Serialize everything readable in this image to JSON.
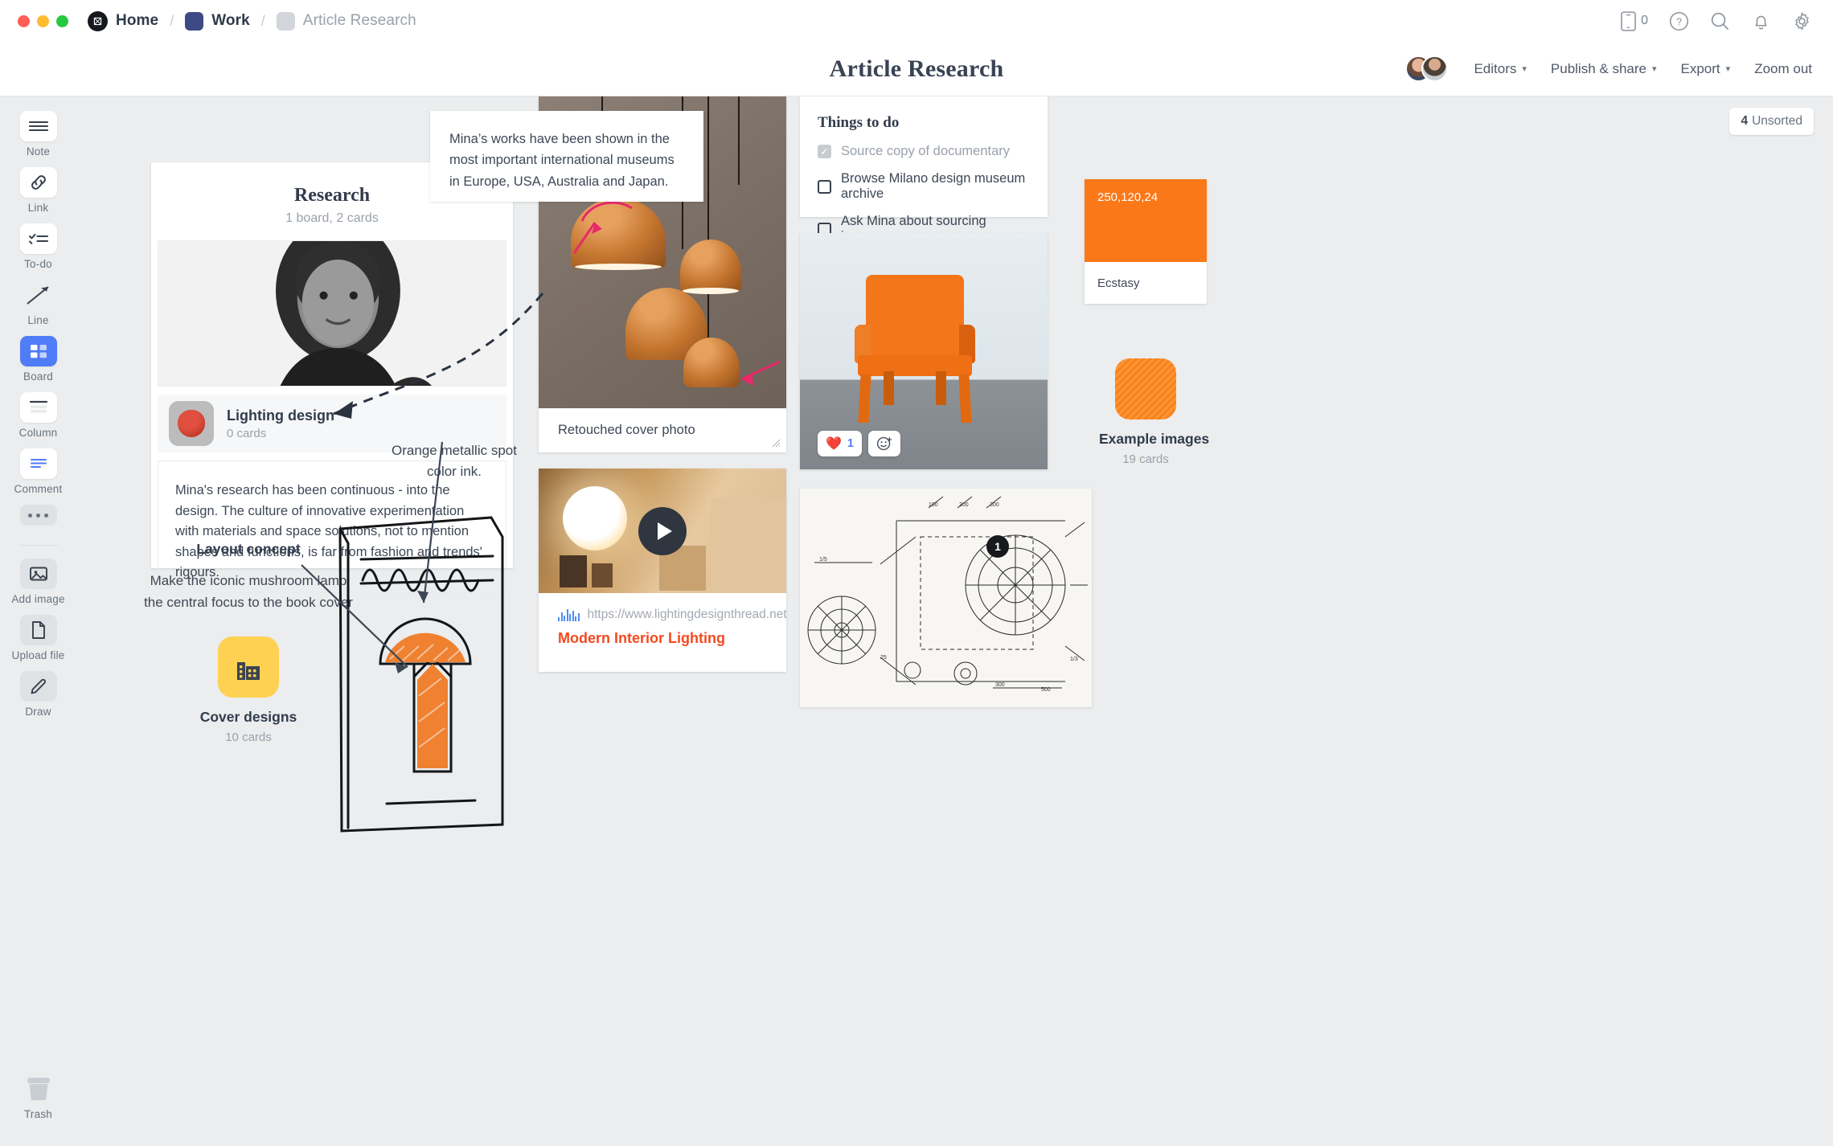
{
  "window": {
    "breadcrumbs": [
      {
        "label": "Home",
        "icon": "milanote-logo-icon"
      },
      {
        "label": "Work",
        "icon": "blue-square-icon"
      },
      {
        "label": "Article Research",
        "icon": "grey-square-icon"
      }
    ],
    "top_icons": [
      {
        "name": "mobile-icon",
        "count": "0"
      },
      {
        "name": "help-icon"
      },
      {
        "name": "search-icon"
      },
      {
        "name": "notifications-icon"
      },
      {
        "name": "settings-gear-icon"
      }
    ]
  },
  "header": {
    "title": "Article Research",
    "editors_label": "Editors",
    "publish_label": "Publish & share",
    "export_label": "Export",
    "zoom_label": "Zoom out"
  },
  "sidebar": {
    "items": [
      {
        "label": "Note",
        "icon": "note-icon",
        "state": "default"
      },
      {
        "label": "Link",
        "icon": "link-icon",
        "state": "default"
      },
      {
        "label": "To-do",
        "icon": "todo-icon",
        "state": "default"
      },
      {
        "label": "Line",
        "icon": "line-arrow-icon",
        "state": "plain"
      },
      {
        "label": "Board",
        "icon": "board-icon",
        "state": "active"
      },
      {
        "label": "Column",
        "icon": "column-icon",
        "state": "default"
      },
      {
        "label": "Comment",
        "icon": "comment-icon",
        "state": "default"
      },
      {
        "label": "Add image",
        "icon": "add-image-icon",
        "state": "grey"
      },
      {
        "label": "Upload file",
        "icon": "upload-file-icon",
        "state": "grey"
      },
      {
        "label": "Draw",
        "icon": "draw-pencil-icon",
        "state": "grey"
      },
      {
        "label": "Trash",
        "icon": "trash-icon",
        "state": "plain"
      }
    ],
    "more_label": "more-options"
  },
  "canvas": {
    "unsorted_badge": {
      "count": "4",
      "label": "Unsorted"
    },
    "research_board": {
      "title": "Research",
      "subtitle": "1 board, 2 cards",
      "photo_alt": "portrait-photo-of-mina",
      "subboard": {
        "name": "Lighting design",
        "cards": "0 cards",
        "thumb": "strawberry-lamp-thumbnail"
      },
      "note": "Mina's research has been continuous - into the design. The culture of innovative experimentation with materials and space solutions, not to mention shapes and functions, is far from fashion and trends' rigours."
    },
    "quote_note": "Mina’s works have been shown in the most important international museums in Europe, USA, Australia and Japan.",
    "pendant_card": {
      "caption": "Retouched cover photo",
      "image_alt": "copper-pendant-lamps-photo",
      "annotation_color": "#e91e63"
    },
    "video_card": {
      "url": "https://www.lightingdesignthread.net",
      "title": "Modern Interior Lighting",
      "image_alt": "bedside-lamp-video-thumbnail",
      "play_icon": "play-icon"
    },
    "todo_card": {
      "heading": "Things to do",
      "items": [
        {
          "text": "Source copy of documentary",
          "checked": true
        },
        {
          "text": "Browse Milano design museum archive",
          "checked": false
        },
        {
          "text": "Ask Mina about sourcing images",
          "checked": false
        }
      ]
    },
    "chair_card": {
      "image_alt": "orange-chair-photo",
      "reaction_emoji": "❤️",
      "reaction_count": "1",
      "add_reaction_icon": "add-reaction-icon"
    },
    "blueprint_card": {
      "image_alt": "technical-blueprint-drawing",
      "badge": "1"
    },
    "color_swatch": {
      "rgb_label": "250,120,24",
      "name": "Ecstasy",
      "hex": "#FA7818"
    },
    "example_images_board": {
      "name": "Example images",
      "cards": "19 cards",
      "icon": "orange-texture-thumbnail"
    },
    "layout_concept": {
      "title": "Layout concept",
      "body": "Make the iconic mushroom lamp the central focus to the book cover"
    },
    "cover_designs_board": {
      "name": "Cover designs",
      "cards": "10 cards",
      "icon": "buildings-icon",
      "color": "#FFD152"
    },
    "ink_note": "Orange metallic spot color ink.",
    "sketch_alt": "hand-drawn-book-cover-sketch"
  }
}
